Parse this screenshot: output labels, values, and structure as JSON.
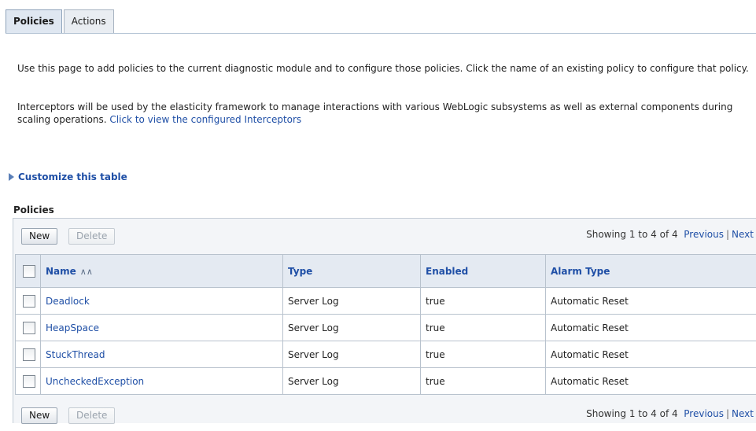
{
  "tabs": [
    {
      "label": "Policies",
      "active": true
    },
    {
      "label": "Actions",
      "active": false
    }
  ],
  "intro": {
    "p1": "Use this page to add policies to the current diagnostic module and to configure those policies. Click the name of an existing policy to configure that policy.",
    "p2_text": "Interceptors will be used by the elasticity framework to manage interactions with various WebLogic subsystems as well as external components during scaling operations. ",
    "p2_link": "Click to view the configured Interceptors"
  },
  "customize_label": "Customize this table",
  "section_title": "Policies",
  "controls": {
    "new_label": "New",
    "delete_label": "Delete",
    "showing": "Showing 1 to 4 of 4",
    "previous": "Previous",
    "separator": "|",
    "next": "Next"
  },
  "table": {
    "columns": [
      "Name",
      "Type",
      "Enabled",
      "Alarm Type"
    ],
    "sort_icon": "sort-ascending-icon",
    "rows": [
      {
        "name": "Deadlock",
        "type": "Server Log",
        "enabled": "true",
        "alarm": "Automatic Reset"
      },
      {
        "name": "HeapSpace",
        "type": "Server Log",
        "enabled": "true",
        "alarm": "Automatic Reset"
      },
      {
        "name": "StuckThread",
        "type": "Server Log",
        "enabled": "true",
        "alarm": "Automatic Reset"
      },
      {
        "name": "UncheckedException",
        "type": "Server Log",
        "enabled": "true",
        "alarm": "Automatic Reset"
      }
    ]
  },
  "colors": {
    "link": "#1f4fa6",
    "header_bg": "#e4eaf2"
  }
}
